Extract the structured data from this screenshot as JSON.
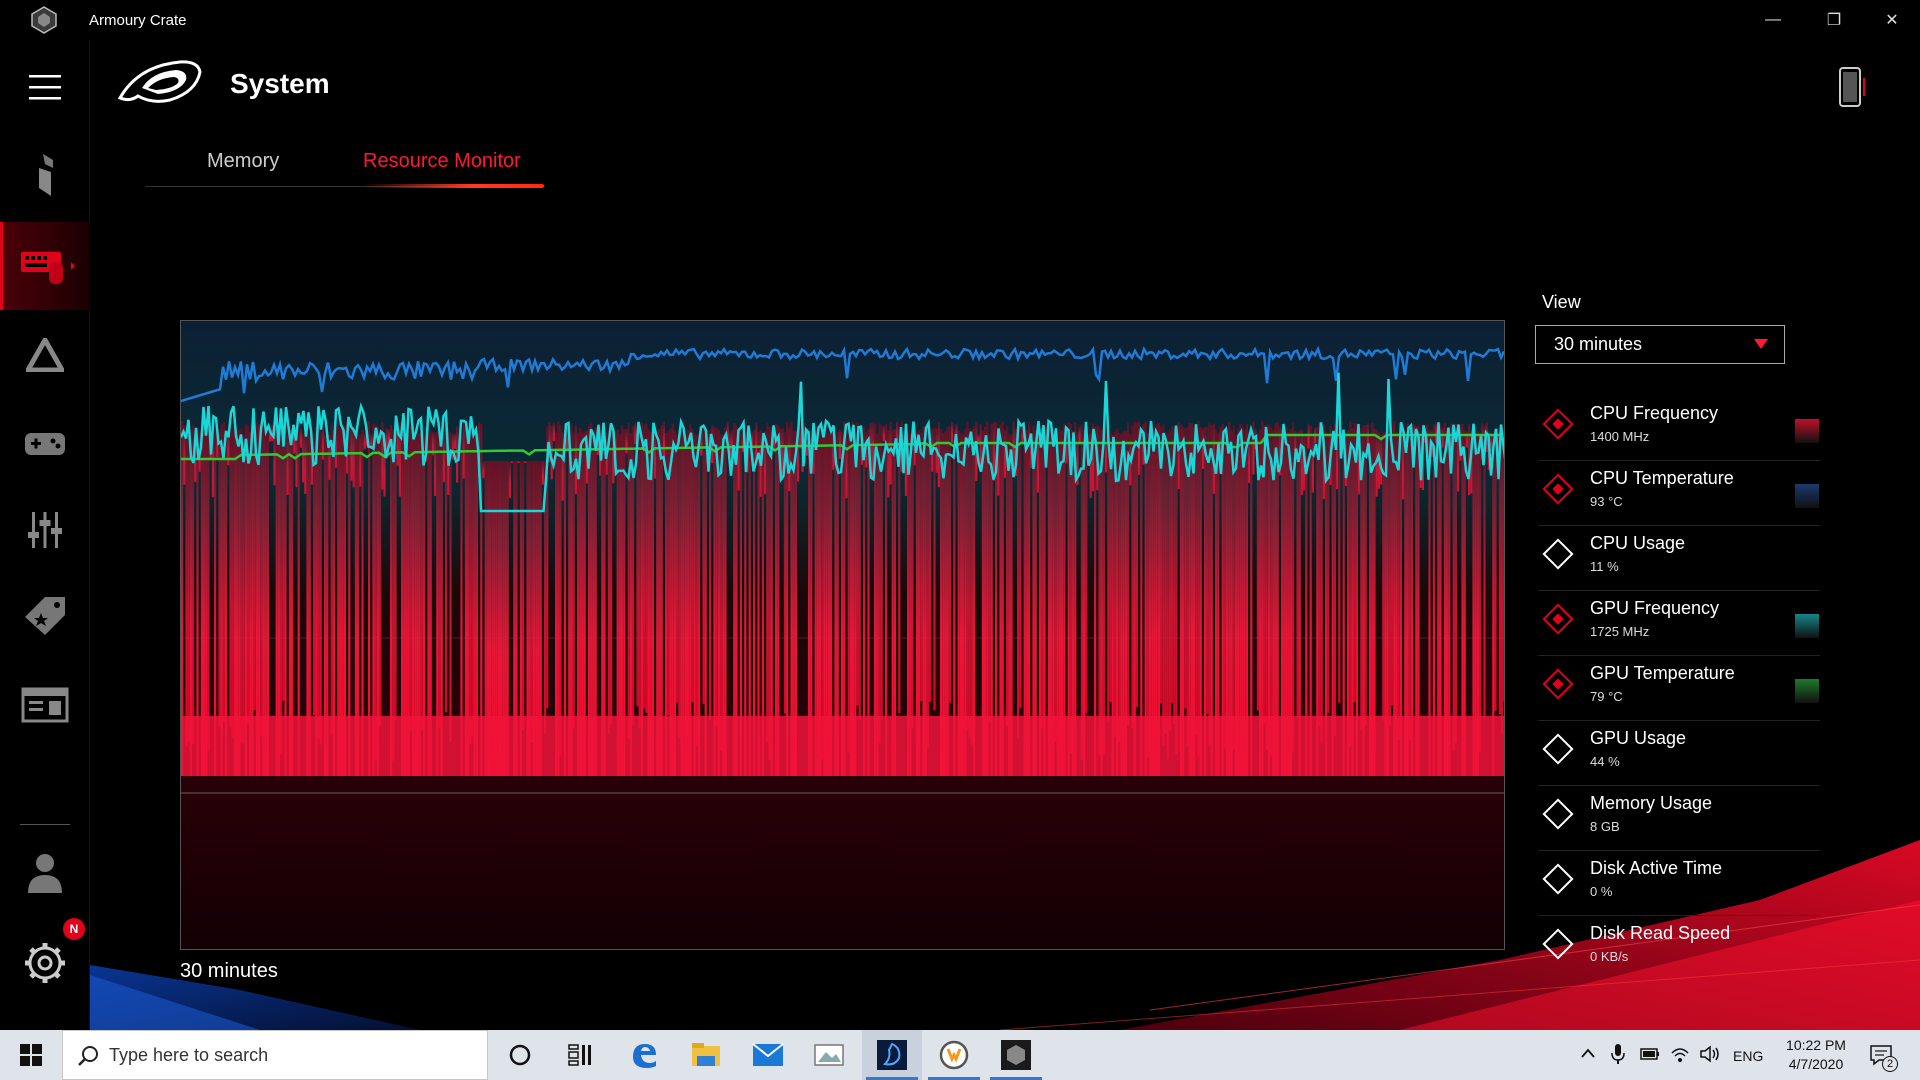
{
  "window": {
    "app_title": "Armoury Crate",
    "minimize_glyph": "—",
    "maximize_glyph": "❐",
    "close_glyph": "✕"
  },
  "rail": {
    "items": [
      {
        "icon": "menu-icon"
      },
      {
        "icon": "home-icon"
      },
      {
        "icon": "system-device-icon",
        "active": true
      },
      {
        "icon": "aura-icon"
      },
      {
        "icon": "gamevisual-icon"
      },
      {
        "icon": "equalizer-icon"
      },
      {
        "icon": "deals-tag-icon"
      },
      {
        "icon": "news-icon"
      },
      {
        "icon": "user-icon"
      },
      {
        "icon": "settings-gear-icon"
      }
    ],
    "notification_badge": "N"
  },
  "header": {
    "page_title": "System"
  },
  "tabs": [
    {
      "label": "Memory",
      "active": false
    },
    {
      "label": "Resource Monitor",
      "active": true
    }
  ],
  "chart": {
    "range_label": "30  minutes",
    "colors": {
      "cpu_frequency": "#e3003a",
      "cpu_temperature": "#1e7bd6",
      "gpu_frequency": "#19d7d7",
      "gpu_temperature": "#2ecc2e"
    }
  },
  "view": {
    "label": "View",
    "selected": "30  minutes"
  },
  "metrics": [
    {
      "name": "CPU Frequency",
      "value": "1400 MHz",
      "enabled": true,
      "swatch": "#c0102a"
    },
    {
      "name": "CPU Temperature",
      "value": "93 °C",
      "enabled": true,
      "swatch": "#1a3a6e"
    },
    {
      "name": "CPU Usage",
      "value": "11 %",
      "enabled": false
    },
    {
      "name": "GPU Frequency",
      "value": "1725 MHz",
      "enabled": true,
      "swatch": "#14868a"
    },
    {
      "name": "GPU Temperature",
      "value": "79 °C",
      "enabled": true,
      "swatch": "#1f7a2a"
    },
    {
      "name": "GPU Usage",
      "value": "44 %",
      "enabled": false
    },
    {
      "name": "Memory Usage",
      "value": "8 GB",
      "enabled": false
    },
    {
      "name": "Disk Active Time",
      "value": "0 %",
      "enabled": false
    },
    {
      "name": "Disk Read Speed",
      "value": "0 KB/s",
      "enabled": false
    }
  ],
  "taskbar": {
    "search_placeholder": "Type here to search",
    "apps": [
      "cortana-icon",
      "task-view-icon",
      "edge-icon",
      "file-explorer-icon",
      "mail-icon",
      "photos-icon",
      "battlenet-icon",
      "overwatch-icon",
      "armoury-crate-icon"
    ],
    "language": "ENG",
    "time": "10:22 PM",
    "date": "4/7/2020",
    "notification_count": "2"
  }
}
